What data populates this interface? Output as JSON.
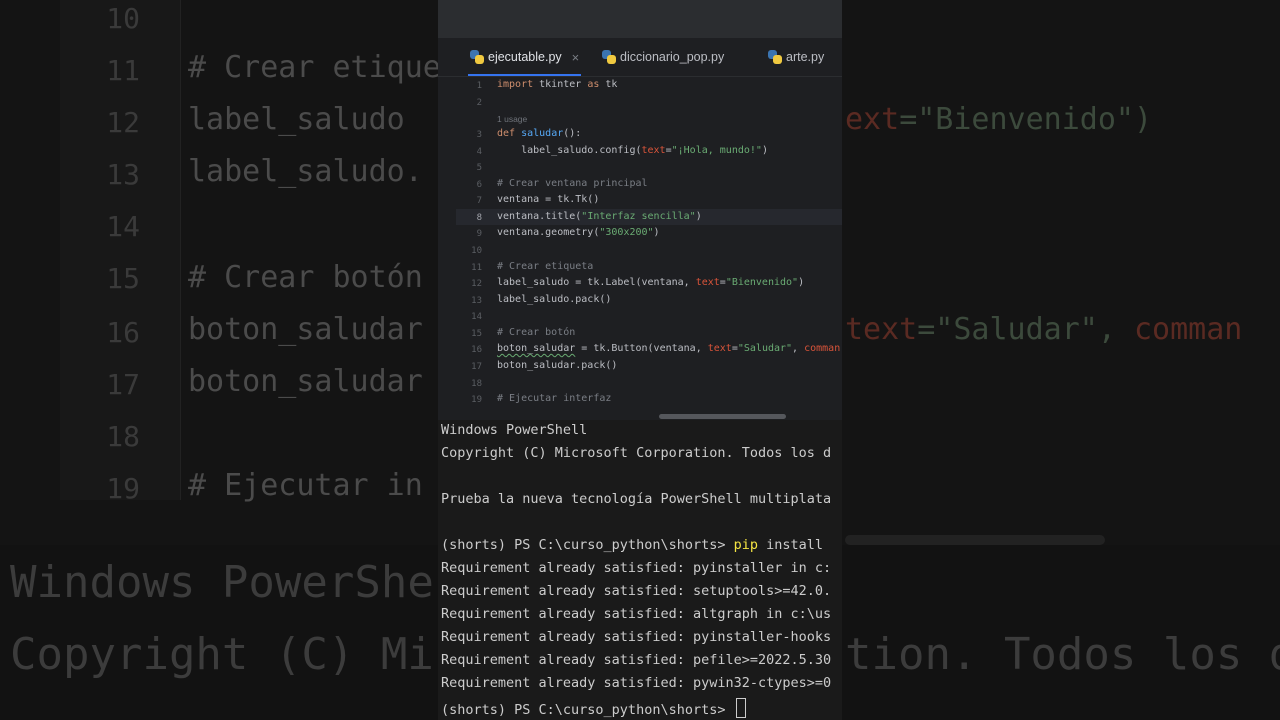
{
  "tabs": [
    {
      "label": "ejecutable.py",
      "active": true,
      "close": "×"
    },
    {
      "label": "diccionario_pop.py",
      "active": false
    },
    {
      "label": "arte.py",
      "active": false
    }
  ],
  "editor": {
    "usage_hint": "1 usage",
    "line_numbers": [
      "1",
      "2",
      "3",
      "4",
      "5",
      "6",
      "7",
      "8",
      "9",
      "10",
      "11",
      "12",
      "13",
      "14",
      "15",
      "16",
      "17",
      "18",
      "19"
    ],
    "current_line": "8",
    "tokens": {
      "l1_import": "import",
      "l1_rest": " tkinter ",
      "l1_as": "as",
      "l1_tk": " tk",
      "l3_def": "def",
      "l3_name": "saludar",
      "l3_rest": "():",
      "l4_pre": "    label_saludo.config(",
      "l4_param": "text",
      "l4_eq": "=",
      "l4_str": "\"¡Hola, mundo!\"",
      "l4_end": ")",
      "l6_comment": "# Crear ventana principal",
      "l7": "ventana = tk.Tk()",
      "l8_pre": "ventana.title(",
      "l8_str": "\"Interfaz sencilla\"",
      "l8_end": ")",
      "l9_pre": "ventana.geometry(",
      "l9_str": "\"300x200\"",
      "l9_end": ")",
      "l11_comment": "# Crear etiqueta",
      "l12_pre": "label_saludo = tk.Label(ventana, ",
      "l12_param": "text",
      "l12_eq": "=",
      "l12_str": "\"Bienvenido\"",
      "l12_end": ")",
      "l13": "label_saludo.pack()",
      "l15_comment": "# Crear botón",
      "l16_var": "boton_saludar",
      "l16_pre": " = tk.Button(ventana, ",
      "l16_param": "text",
      "l16_eq": "=",
      "l16_str": "\"Saludar\"",
      "l16_comma": ", ",
      "l16_cmd": "comman",
      "l17": "boton_saludar.pack()",
      "l19_comment": "# Ejecutar interfaz"
    }
  },
  "terminal": {
    "lines": [
      "Windows PowerShell",
      "Copyright (C) Microsoft Corporation. Todos los d",
      "",
      "Prueba la nueva tecnología PowerShell multiplata",
      ""
    ],
    "cmd_prompt": "(shorts) PS C:\\curso_python\\shorts> ",
    "cmd_pip": "pip",
    "cmd_rest": " install",
    "requirements": [
      "Requirement already satisfied: pyinstaller in c:",
      "Requirement already satisfied: setuptools>=42.0.",
      "Requirement already satisfied: altgraph in c:\\us",
      "Requirement already satisfied: pyinstaller-hooks",
      "Requirement already satisfied: pefile>=2022.5.30",
      "Requirement already satisfied: pywin32-ctypes>=0"
    ],
    "final_prompt": "(shorts) PS C:\\curso_python\\shorts> "
  },
  "background": {
    "nums": [
      "10",
      "11",
      "12",
      "13",
      "14",
      "15",
      "16",
      "17",
      "18",
      "19"
    ],
    "code": [
      "# Crear etique",
      "label_saludo ",
      "label_saludo.",
      "",
      "# Crear botón",
      "boton_saludar",
      "boton_saludar",
      "",
      "# Ejecutar in"
    ],
    "right_1_param": "ext",
    "right_1_rest": "=\"Bienvenido\")",
    "right_2_param": "text",
    "right_2_str": "=\"Saludar\", ",
    "right_2_cmd": "comman",
    "term_1": "Windows PowerShe",
    "term_2a": "Copyright (C) Mi",
    "term_2b": "tion. Todos los d"
  },
  "colors": {
    "keyword": "#cf8e6d",
    "function": "#56a8f5",
    "string": "#6aab73",
    "comment": "#7a7e85",
    "named_arg": "#d9543a",
    "pip": "#f4e442",
    "accent": "#3574f0"
  }
}
